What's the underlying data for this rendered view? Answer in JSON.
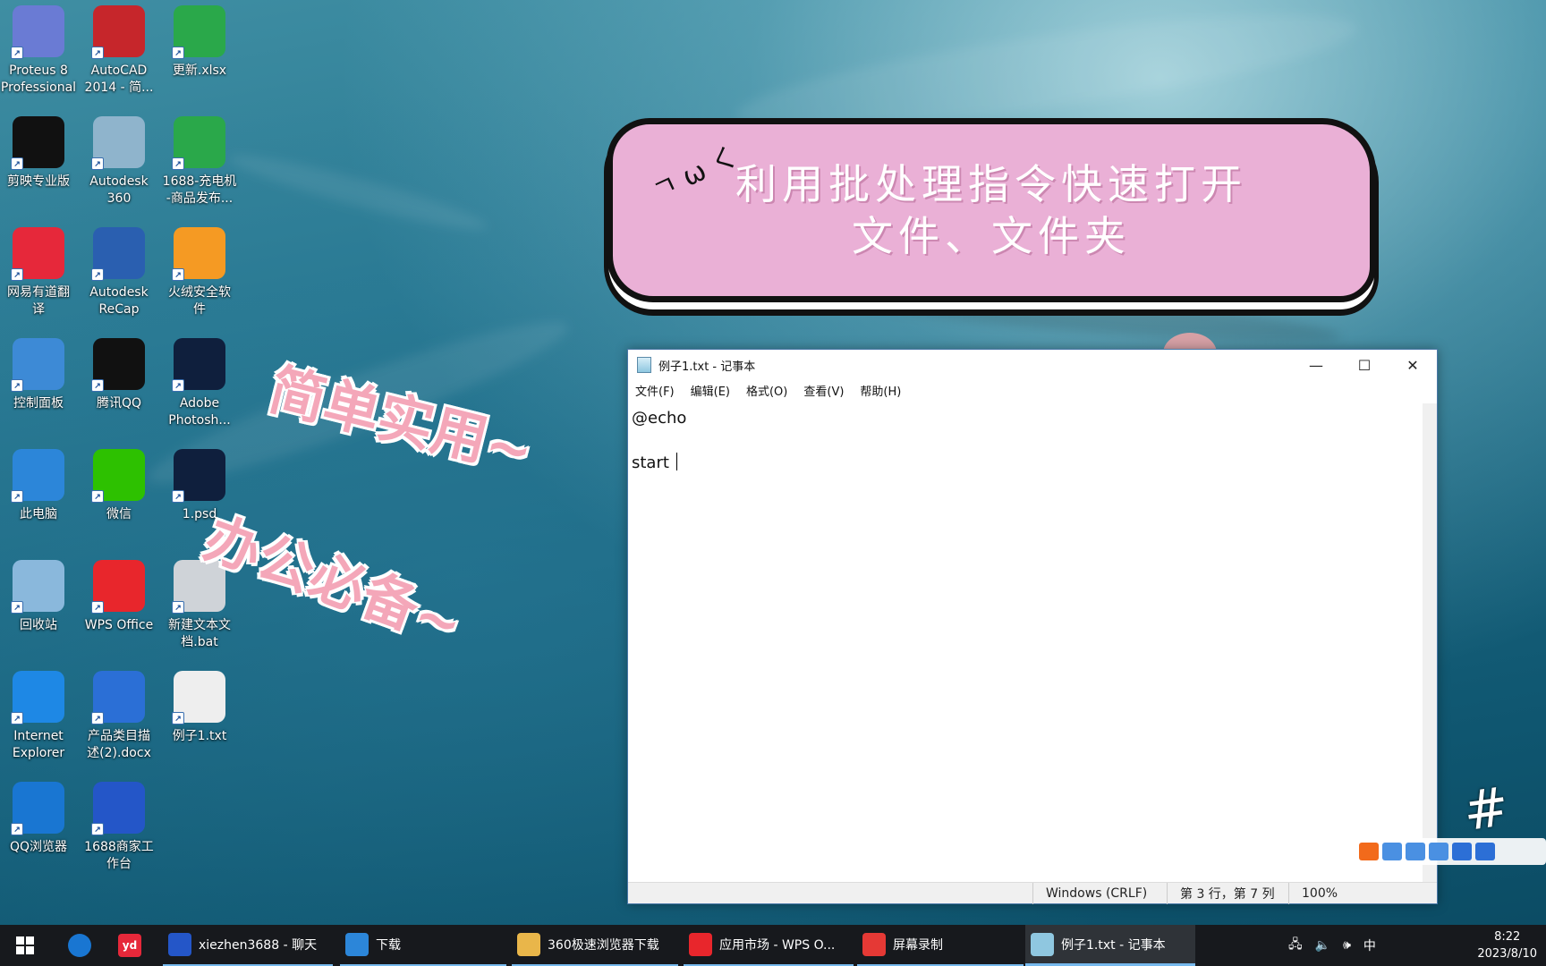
{
  "desktop": {
    "icons": [
      {
        "label": "Proteus 8\nProfessional",
        "icon": "proteus-icon",
        "color": "#6a7bd4"
      },
      {
        "label": "AutoCAD\n2014 - 简...",
        "icon": "autocad-icon",
        "color": "#c6262b"
      },
      {
        "label": "更新.xlsx",
        "icon": "spreadsheet-icon",
        "color": "#2aa84a"
      },
      {
        "label": "剪映专业版",
        "icon": "capcut-icon",
        "color": "#111111"
      },
      {
        "label": "Autodesk\n360",
        "icon": "autodesk360-icon",
        "color": "#8fb4cc"
      },
      {
        "label": "1688-充电机\n-商品发布...",
        "icon": "spreadsheet-icon",
        "color": "#2aa84a"
      },
      {
        "label": "网易有道翻\n译",
        "icon": "youdao-icon",
        "color": "#e6283a"
      },
      {
        "label": "Autodesk\nReCap",
        "icon": "recap-icon",
        "color": "#2a5fb0"
      },
      {
        "label": "火绒安全软\n件",
        "icon": "huorong-icon",
        "color": "#f59a23"
      },
      {
        "label": "控制面板",
        "icon": "control-panel-icon",
        "color": "#3d8ad6"
      },
      {
        "label": "腾讯QQ",
        "icon": "qq-icon",
        "color": "#111111"
      },
      {
        "label": "Adobe\nPhotosh...",
        "icon": "photoshop-icon",
        "color": "#0f1f3d"
      },
      {
        "label": "此电脑",
        "icon": "this-pc-icon",
        "color": "#2c86d9"
      },
      {
        "label": "微信",
        "icon": "wechat-icon",
        "color": "#2dc100"
      },
      {
        "label": "1.psd",
        "icon": "psd-file-icon",
        "color": "#0f1f3d"
      },
      {
        "label": "回收站",
        "icon": "recycle-bin-icon",
        "color": "#8ab8dc"
      },
      {
        "label": "WPS Office",
        "icon": "wps-icon",
        "color": "#e8262c"
      },
      {
        "label": "新建文本文\n档.bat",
        "icon": "bat-file-icon",
        "color": "#cfd3d8"
      },
      {
        "label": "Internet\nExplorer",
        "icon": "ie-icon",
        "color": "#1e88e5"
      },
      {
        "label": "产品类目描\n述(2).docx",
        "icon": "word-doc-icon",
        "color": "#2b6fd6"
      },
      {
        "label": "例子1.txt",
        "icon": "txt-file-icon",
        "color": "#eeeeee"
      },
      {
        "label": "QQ浏览器",
        "icon": "qq-browser-icon",
        "color": "#1976d2"
      },
      {
        "label": "1688商家工\n作台",
        "icon": "1688-icon",
        "color": "#2456c8"
      }
    ]
  },
  "overlay": {
    "title": "利用批处理指令快速打开\n文件、文件夹",
    "sticker1": "简单实用~",
    "sticker2": "办公必备~",
    "deco": "ㄱ ω く",
    "hash": "#"
  },
  "notepad": {
    "title": "例子1.txt - 记事本",
    "menu": [
      "文件(F)",
      "编辑(E)",
      "格式(O)",
      "查看(V)",
      "帮助(H)"
    ],
    "lines": [
      "@echo",
      "",
      "start "
    ],
    "status": {
      "encoding": "Windows (CRLF)",
      "position": "第 3 行，第 7 列",
      "zoom": "100%"
    },
    "controls": {
      "minimize": "—",
      "maximize": "☐",
      "close": "✕"
    }
  },
  "taskbar": {
    "items": [
      {
        "label": "xiezhen3688 - 聊天",
        "icon": "1688-icon",
        "color": "#2456c8"
      },
      {
        "label": "下载",
        "icon": "download-icon",
        "color": "#2c86d9"
      },
      {
        "label": "360极速浏览器下载",
        "icon": "folder-icon",
        "color": "#e9b64a"
      },
      {
        "label": "应用市场 - WPS O...",
        "icon": "wps-icon",
        "color": "#e8262c"
      },
      {
        "label": "屏幕录制",
        "icon": "record-icon",
        "color": "#e53935"
      },
      {
        "label": "例子1.txt - 记事本",
        "icon": "notepad-icon",
        "color": "#8fc7e0"
      }
    ],
    "ime": "中",
    "time": "8:22",
    "date": "2023/8/10"
  }
}
